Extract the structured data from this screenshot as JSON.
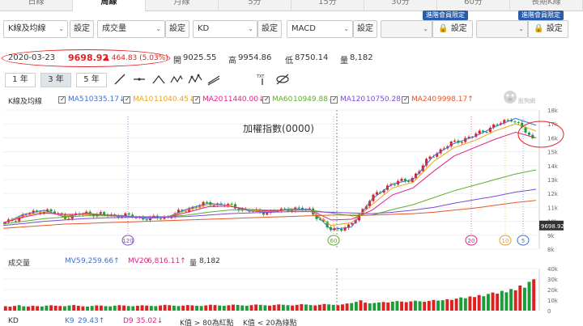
{
  "tabs": [
    "日線",
    "周線",
    "月線",
    "5分",
    "15分",
    "30分",
    "60分",
    "長期K線"
  ],
  "active_tab": 1,
  "selectors": {
    "main": "K線及均線",
    "volume": "成交量",
    "indicator1": "KD",
    "indicator2": "MACD",
    "setting_label": "設定",
    "lock_label": "設定",
    "member_badge": "進階會員限定"
  },
  "price": {
    "date": "2020-03-23",
    "close": "9698.92",
    "change": "▲ 464.83 (5.03%)",
    "open_label": "開",
    "open": "9025.55",
    "high_label": "高",
    "high": "9954.86",
    "low_label": "低",
    "low": "8750.14",
    "volume_label": "量",
    "volume": "8,182"
  },
  "periods": [
    "1 年",
    "3 年",
    "5 年"
  ],
  "active_period": 1,
  "tools": [
    "line-tool",
    "horizontal-line-tool",
    "angle-tool",
    "wave-tool",
    "fibonacci-tool",
    "text-tool",
    "hide-tool"
  ],
  "legend_main": {
    "label": "K線及均線",
    "ma": [
      {
        "name": "MA5",
        "value": "10335.17↓",
        "color": "#3d6fd1"
      },
      {
        "name": "MA10",
        "value": "11040.45↓",
        "color": "#e8a317"
      },
      {
        "name": "MA20",
        "value": "11440.00↓",
        "color": "#e0208a"
      },
      {
        "name": "MA60",
        "value": "10949.88↓",
        "color": "#5fae2e"
      },
      {
        "name": "MA120",
        "value": "10750.28↓",
        "color": "#7b4bd6"
      },
      {
        "name": "MA240",
        "value": "9998.17↑",
        "color": "#e2582a"
      }
    ]
  },
  "chart_title": "加權指數(0000)",
  "watermark": "股狗網",
  "current_price_tag": "9698.92",
  "ma_markers": [
    "120",
    "60",
    "20",
    "10",
    "5"
  ],
  "legend_volume": {
    "label": "成交量",
    "mv5_name": "MV5",
    "mv5_value": "9,259.66↑",
    "mv20_name": "MV20",
    "mv20_value": "6,816.11↑",
    "vol_name": "量",
    "vol_value": "8,182"
  },
  "legend_kd": {
    "label": "KD",
    "k_name": "K9",
    "k_value": "29.43↑",
    "d_name": "D9",
    "d_value": "35.02↓",
    "note1": "K值 > 80為紅點",
    "note2": "K值 < 20為綠點"
  },
  "chart_data": [
    {
      "type": "line",
      "ylim": [
        8000,
        18000
      ],
      "y_ticks": [
        "18k",
        "17k",
        "16k",
        "15k",
        "14k",
        "13k",
        "12k",
        "11k",
        "10k",
        "9k",
        "8k"
      ],
      "series": [
        {
          "name": "MA5",
          "values": [
            9850,
            10500,
            10800,
            10300,
            10600,
            10450,
            10400,
            10200,
            10300,
            10900,
            11300,
            11150,
            10750,
            10650,
            10900,
            10850,
            9400,
            9600,
            11600,
            12700,
            13000,
            14700,
            15600,
            16100,
            16800,
            17400,
            16900
          ]
        },
        {
          "name": "MA10",
          "values": [
            9900,
            10400,
            10700,
            10400,
            10550,
            10450,
            10350,
            10250,
            10300,
            10800,
            11200,
            11150,
            10800,
            10700,
            10850,
            10800,
            9700,
            9900,
            11200,
            12400,
            12800,
            14300,
            15300,
            15800,
            16500,
            17000,
            16500
          ]
        },
        {
          "name": "MA20",
          "values": [
            9900,
            10300,
            10600,
            10500,
            10500,
            10450,
            10350,
            10300,
            10300,
            10650,
            11050,
            11100,
            10850,
            10750,
            10800,
            10800,
            10100,
            10150,
            10800,
            11900,
            12400,
            13600,
            14700,
            15300,
            15900,
            16400,
            16000
          ]
        },
        {
          "name": "MA60",
          "values": [
            9800,
            10000,
            10200,
            10300,
            10400,
            10400,
            10350,
            10330,
            10330,
            10450,
            10650,
            10800,
            10850,
            10800,
            10800,
            10800,
            10600,
            10400,
            10450,
            10850,
            11200,
            11700,
            12200,
            12600,
            13000,
            13400,
            13700
          ]
        },
        {
          "name": "MA120",
          "values": [
            9700,
            9850,
            10000,
            10100,
            10200,
            10250,
            10280,
            10300,
            10300,
            10350,
            10450,
            10550,
            10600,
            10650,
            10700,
            10700,
            10650,
            10600,
            10550,
            10650,
            10800,
            11000,
            11300,
            11550,
            11800,
            12100,
            12300
          ]
        },
        {
          "name": "MA240",
          "values": [
            9500,
            9600,
            9700,
            9800,
            9850,
            9900,
            9950,
            10000,
            10050,
            10100,
            10150,
            10200,
            10250,
            10300,
            10350,
            10400,
            10450,
            10450,
            10450,
            10500,
            10550,
            10650,
            10800,
            10950,
            11150,
            11350,
            11500
          ]
        }
      ],
      "price_series": [
        9850,
        10500,
        10800,
        10300,
        10600,
        10450,
        10400,
        10200,
        10300,
        10900,
        11300,
        11150,
        10750,
        10650,
        10900,
        10850,
        9400,
        9600,
        11600,
        12700,
        13000,
        14700,
        15600,
        16100,
        16800,
        17400,
        15900
      ]
    },
    {
      "type": "bar",
      "ylim": [
        0,
        40000
      ],
      "y_ticks": [
        "40k",
        "30k",
        "20k",
        "10k",
        "0"
      ],
      "values": [
        4200,
        3800,
        4500,
        5200,
        4100,
        3900,
        4600,
        4300,
        4000,
        4800,
        5100,
        4700,
        4400,
        4200,
        4900,
        5300,
        4600,
        4100,
        3900,
        4500,
        5000,
        4800,
        4300,
        4100,
        4700,
        5200,
        4900,
        4400,
        4200,
        4600,
        5100,
        4800,
        4500,
        4300,
        4900,
        5500,
        5200,
        4700,
        4400,
        4800,
        5300,
        5000,
        4600,
        4400,
        5000,
        5600,
        5300,
        4900,
        4600,
        5100,
        5700,
        5400,
        5000,
        4700,
        5200,
        5800,
        5500,
        5100,
        4800,
        5300,
        5900,
        5600,
        5200,
        4900,
        5500,
        6200,
        5800,
        5300,
        5000,
        5600,
        6300,
        5900,
        5500,
        5200,
        5900,
        6800,
        7200,
        8400,
        9800,
        7600,
        6900,
        7300,
        7800,
        8200,
        7700,
        8500,
        9100,
        8600,
        8100,
        8800,
        9400,
        8900,
        8400,
        9200,
        10100,
        9500,
        9900,
        10800,
        10200,
        11400,
        12600,
        11800,
        13500,
        12900,
        14800,
        13700,
        15900,
        17200,
        16100,
        18800,
        17400,
        20600,
        19300,
        23900,
        21800,
        27400,
        29800
      ]
    }
  ]
}
